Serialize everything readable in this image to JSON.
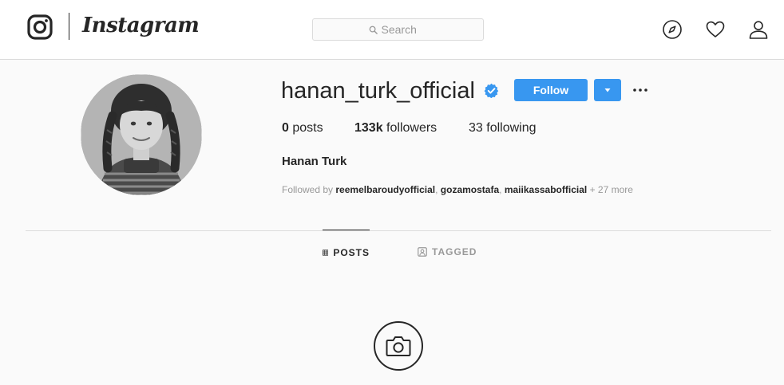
{
  "nav": {
    "wordmark": "Instagram",
    "search_placeholder": "Search",
    "icons": [
      "instagram-logo-icon",
      "search-icon",
      "explore-compass-icon",
      "activity-heart-icon",
      "profile-person-icon"
    ]
  },
  "profile": {
    "username": "hanan_turk_official",
    "verified": true,
    "follow_label": "Follow",
    "stats": {
      "posts_count": "0",
      "posts_label": "posts",
      "followers_count": "133k",
      "followers_label": "followers",
      "following_count": "33",
      "following_label": "following"
    },
    "full_name": "Hanan Turk",
    "followed_by": {
      "prefix": "Followed by",
      "users": [
        "reemelbaroudyofficial",
        "gozamostafa",
        "maiikassabofficial"
      ],
      "separator": ",",
      "more": "+ 27 more"
    }
  },
  "tabs": [
    {
      "label": "POSTS",
      "icon": "grid-icon",
      "active": true
    },
    {
      "label": "TAGGED",
      "icon": "tagged-icon",
      "active": false
    }
  ],
  "empty_state": {
    "icon": "camera-icon"
  },
  "colors": {
    "accent": "#3897f0",
    "text": "#262626",
    "muted": "#999999",
    "border": "#dbdbdb",
    "background": "#fafafa"
  }
}
